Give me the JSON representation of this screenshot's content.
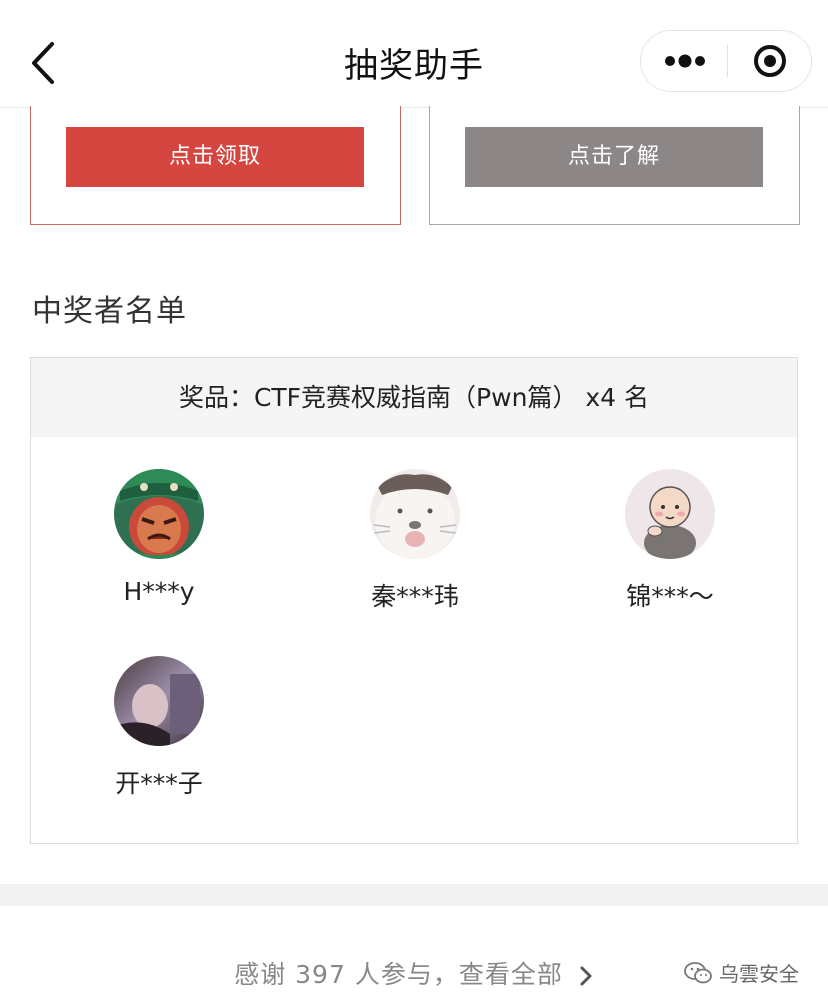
{
  "navbar": {
    "title": "抽奖助手",
    "back_icon": "chevron-left-icon",
    "more_icon": "more-dots-icon",
    "close_icon": "target-close-icon"
  },
  "cards": {
    "left_button": "点击领取",
    "right_button": "点击了解"
  },
  "winners_section": {
    "title": "中奖者名单",
    "prize_line": "奖品：CTF竞赛权威指南（Pwn篇） x4 名",
    "winners": [
      {
        "name": "H***y",
        "avatar": "cartoon-pirate-avatar"
      },
      {
        "name": "秦***玮",
        "avatar": "white-dog-avatar"
      },
      {
        "name": "锦***～",
        "avatar": "bald-boy-avatar"
      },
      {
        "name": "开***子",
        "avatar": "photo-avatar"
      }
    ]
  },
  "footer": {
    "link_text": "感谢 397 人参与，查看全部",
    "watermark": "乌雲安全"
  },
  "colors": {
    "claim_button": "#d54641",
    "learn_button": "#8d8687"
  }
}
